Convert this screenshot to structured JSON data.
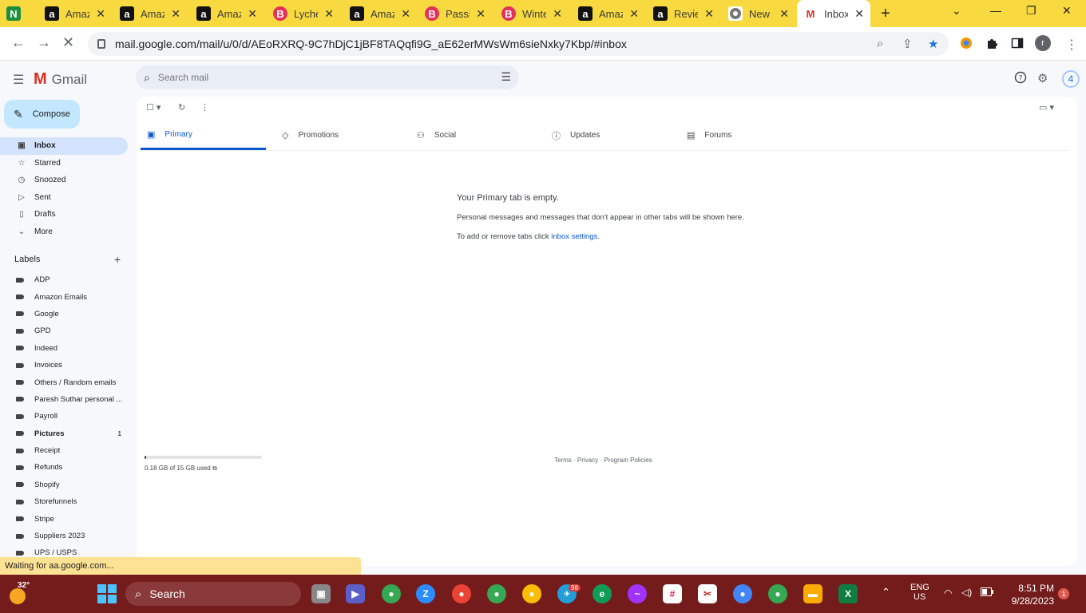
{
  "browser": {
    "tabs": [
      {
        "title": "",
        "icon": "n-icon",
        "color": "#1e8e3e"
      },
      {
        "title": "Amazon",
        "icon": "amazon-icon"
      },
      {
        "title": "Amazon",
        "icon": "amazon-icon"
      },
      {
        "title": "Amazon",
        "icon": "amazon-icon"
      },
      {
        "title": "Lychee",
        "icon": "b-icon"
      },
      {
        "title": "Amazon",
        "icon": "amazon-icon"
      },
      {
        "title": "Passion",
        "icon": "b-icon"
      },
      {
        "title": "Winter",
        "icon": "b-icon"
      },
      {
        "title": "Amazon",
        "icon": "amazon-icon"
      },
      {
        "title": "Reviews",
        "icon": "amazon-icon"
      },
      {
        "title": "New",
        "icon": "chrome-icon"
      },
      {
        "title": "Inbox",
        "icon": "gmail-icon",
        "active": true
      }
    ],
    "url": "mail.google.com/mail/u/0/d/AEoRXRQ-9C7hDjC1jBF8TAQqfi9G_aE62erMWsWm6sieNxky7Kbp/#inbox",
    "profile_initial": "r",
    "status": "Waiting for aa.google.com..."
  },
  "gmail": {
    "logo_text": "Gmail",
    "search_placeholder": "Search mail",
    "account_initial": "4",
    "compose_label": "Compose",
    "nav": [
      {
        "label": "Inbox",
        "icon": "inbox-icon",
        "selected": true
      },
      {
        "label": "Starred",
        "icon": "star-icon"
      },
      {
        "label": "Snoozed",
        "icon": "clock-icon"
      },
      {
        "label": "Sent",
        "icon": "send-icon"
      },
      {
        "label": "Drafts",
        "icon": "draft-icon"
      },
      {
        "label": "More",
        "icon": "chevron-down-icon"
      }
    ],
    "labels_title": "Labels",
    "labels": [
      {
        "name": "ADP"
      },
      {
        "name": "Amazon Emails"
      },
      {
        "name": "Google"
      },
      {
        "name": "GPD"
      },
      {
        "name": "Indeed"
      },
      {
        "name": "Invoices"
      },
      {
        "name": "Others / Random emails"
      },
      {
        "name": "Paresh Suthar personal ..."
      },
      {
        "name": "Payroll"
      },
      {
        "name": "Pictures",
        "count": "1",
        "bold": true
      },
      {
        "name": "Receipt"
      },
      {
        "name": "Refunds"
      },
      {
        "name": "Shopify"
      },
      {
        "name": "Storefunnels"
      },
      {
        "name": "Stripe"
      },
      {
        "name": "Suppliers 2023"
      },
      {
        "name": "UPS / USPS"
      }
    ],
    "inbox_tabs": [
      {
        "label": "Primary",
        "icon": "inbox-icon",
        "active": true
      },
      {
        "label": "Promotions",
        "icon": "tag-icon"
      },
      {
        "label": "Social",
        "icon": "people-icon"
      },
      {
        "label": "Updates",
        "icon": "info-icon"
      },
      {
        "label": "Forums",
        "icon": "forum-icon"
      }
    ],
    "empty": {
      "title": "Your Primary tab is empty.",
      "desc": "Personal messages and messages that don't appear in other tabs will be shown here.",
      "settings_prefix": "To add or remove tabs click ",
      "settings_link": "inbox settings",
      "settings_suffix": "."
    },
    "storage": {
      "text": "0.18 GB of 15 GB used",
      "fraction": 0.012
    },
    "footer": "Terms · Privacy · Program Policies"
  },
  "taskbar": {
    "temperature": "32°",
    "search_label": "Search",
    "lang_top": "ENG",
    "lang_bottom": "US",
    "time": "8:51 PM",
    "date": "9/28/2023",
    "notifications": "1",
    "telegram_badge": "98"
  }
}
